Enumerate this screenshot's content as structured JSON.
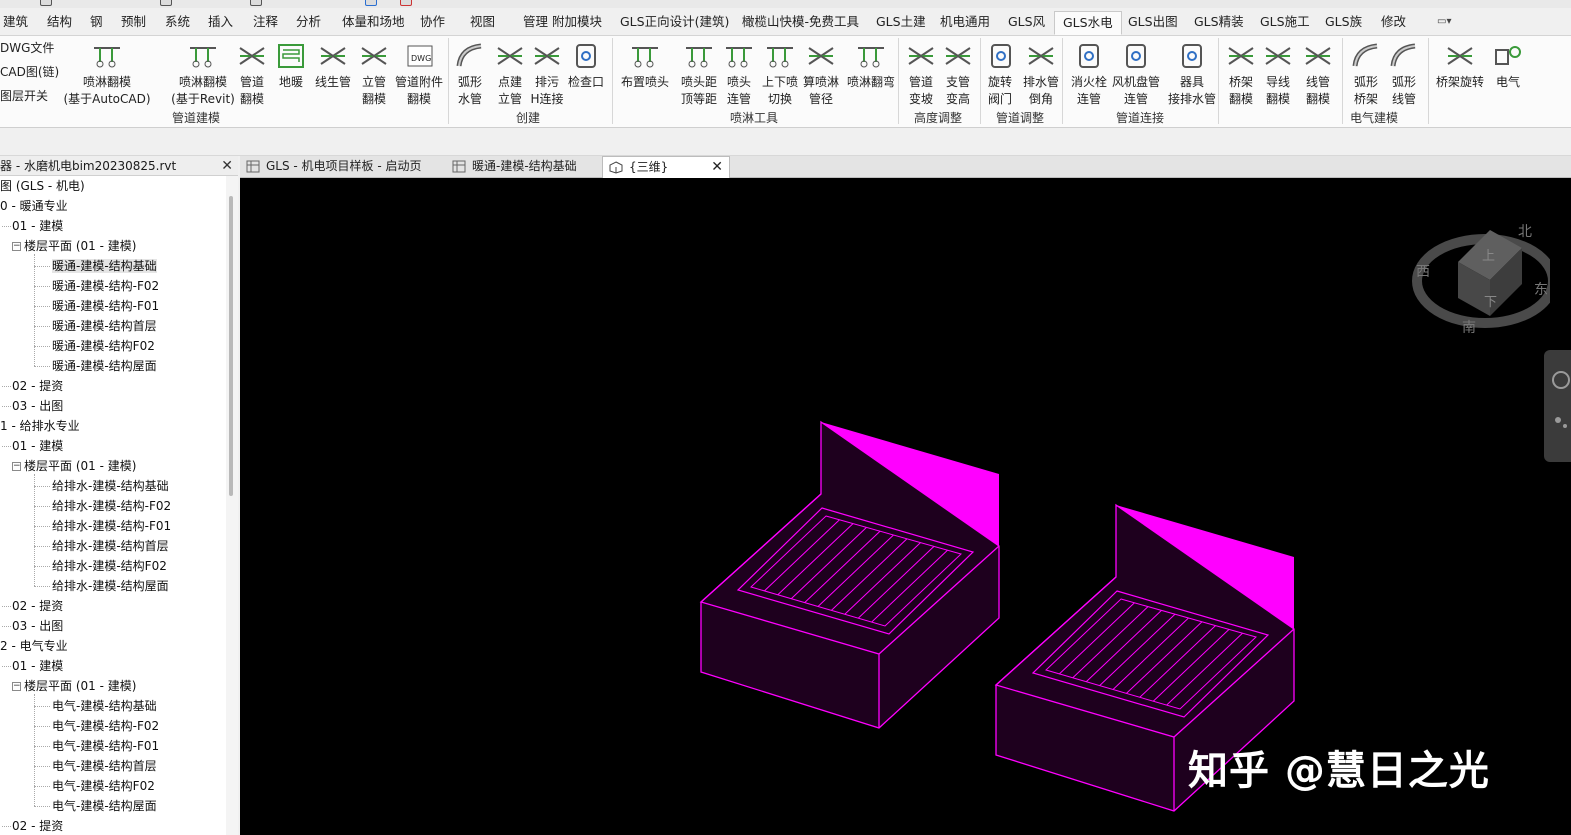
{
  "ribbon_tabs": [
    {
      "label": "建筑",
      "active": false
    },
    {
      "label": "结构",
      "active": false
    },
    {
      "label": "钢",
      "active": false
    },
    {
      "label": "预制",
      "active": false
    },
    {
      "label": "系统",
      "active": false
    },
    {
      "label": "插入",
      "active": false
    },
    {
      "label": "注释",
      "active": false
    },
    {
      "label": "分析",
      "active": false
    },
    {
      "label": "体量和场地",
      "active": false
    },
    {
      "label": "协作",
      "active": false
    },
    {
      "label": "视图",
      "active": false
    },
    {
      "label": "管理",
      "active": false
    },
    {
      "label": "附加模块",
      "active": false
    },
    {
      "label": "GLS正向设计(建筑)",
      "active": false
    },
    {
      "label": "橄榄山快模-免费工具",
      "active": false
    },
    {
      "label": "GLS土建",
      "active": false
    },
    {
      "label": "机电通用",
      "active": false
    },
    {
      "label": "GLS风",
      "active": false
    },
    {
      "label": "GLS水电",
      "active": true
    },
    {
      "label": "GLS出图",
      "active": false
    },
    {
      "label": "GLS精装",
      "active": false
    },
    {
      "label": "GLS施工",
      "active": false
    },
    {
      "label": "GLS族",
      "active": false
    },
    {
      "label": "修改",
      "active": false
    }
  ],
  "ribbon_left_small": [
    "DWG文件",
    "CAD图(链)",
    "图层开关"
  ],
  "ribbon_buttons": [
    {
      "label": "喷淋翻模\n(基于AutoCAD)",
      "icon": "sprinkler-grid-icon"
    },
    {
      "label": "喷淋翻模\n(基于Revit)",
      "icon": "sprinkler-dwg-icon"
    },
    {
      "label": "管道\n翻模",
      "icon": "pipe-layers-icon"
    },
    {
      "label": "地暖",
      "icon": "floor-heating-icon"
    },
    {
      "label": "线生管",
      "icon": "line-to-pipe-icon"
    },
    {
      "label": "立管\n翻模",
      "icon": "riser-icon"
    },
    {
      "label": "管道附件\n翻模",
      "icon": "pipe-accessory-dwg-icon"
    },
    {
      "label": "弧形\n水管",
      "icon": "arc-pipe-icon"
    },
    {
      "label": "点建\n立管",
      "icon": "point-riser-icon"
    },
    {
      "label": "排污\nH连接",
      "icon": "h-connect-icon"
    },
    {
      "label": "检查口",
      "icon": "inspection-port-icon"
    },
    {
      "label": "布置喷头",
      "icon": "place-sprinkler-icon"
    },
    {
      "label": "喷头距\n顶等距",
      "icon": "sprinkler-spacing-icon"
    },
    {
      "label": "喷头\n连管",
      "icon": "sprinkler-connect-icon"
    },
    {
      "label": "上下喷\n切换",
      "icon": "sprinkler-switch-icon"
    },
    {
      "label": "算喷淋\n管径",
      "icon": "pipe-diameter-icon"
    },
    {
      "label": "喷淋翻弯",
      "icon": "sprinkler-bend-icon"
    },
    {
      "label": "管道\n变坡",
      "icon": "pipe-slope-icon"
    },
    {
      "label": "支管\n变高",
      "icon": "branch-height-icon"
    },
    {
      "label": "旋转\n阀门",
      "icon": "rotate-valve-icon"
    },
    {
      "label": "排水管\n倒角",
      "icon": "drain-chamfer-icon"
    },
    {
      "label": "消火栓\n连管",
      "icon": "hydrant-icon"
    },
    {
      "label": "风机盘管\n连管",
      "icon": "fan-coil-icon"
    },
    {
      "label": "器具\n接排水管",
      "icon": "fixture-drain-icon"
    },
    {
      "label": "桥架\n翻模",
      "icon": "tray-model-icon"
    },
    {
      "label": "导线\n翻模",
      "icon": "wire-model-icon"
    },
    {
      "label": "线管\n翻模",
      "icon": "conduit-model-icon"
    },
    {
      "label": "弧形\n桥架",
      "icon": "arc-tray-icon"
    },
    {
      "label": "弧形\n线管",
      "icon": "arc-conduit-icon"
    },
    {
      "label": "桥架旋转",
      "icon": "tray-rotate-icon"
    },
    {
      "label": "电气",
      "icon": "electrical-icon"
    }
  ],
  "ribbon_panels": [
    "管道建模",
    "创建",
    "喷淋工具",
    "高度调整",
    "管道调整",
    "管道连接",
    "电气建模"
  ],
  "browser": {
    "title": "器 - 水磨机电bim20230825.rvt",
    "close": "✕"
  },
  "tree": [
    {
      "label": "图 (GLS - 机电)",
      "level": 0,
      "toggle": "",
      "selected": false
    },
    {
      "label": "0 - 暖通专业",
      "level": 0,
      "toggle": "",
      "selected": false
    },
    {
      "label": "01 - 建模",
      "level": 1,
      "toggle": "",
      "selected": false
    },
    {
      "label": "楼层平面 (01 - 建模)",
      "level": 2,
      "toggle": "−",
      "selected": false
    },
    {
      "label": "暖通-建模-结构基础",
      "level": 3,
      "toggle": "",
      "selected": true
    },
    {
      "label": "暖通-建模-结构-F02",
      "level": 3,
      "toggle": "",
      "selected": false
    },
    {
      "label": "暖通-建模-结构-F01",
      "level": 3,
      "toggle": "",
      "selected": false
    },
    {
      "label": "暖通-建模-结构首层",
      "level": 3,
      "toggle": "",
      "selected": false
    },
    {
      "label": "暖通-建模-结构F02",
      "level": 3,
      "toggle": "",
      "selected": false
    },
    {
      "label": "暖通-建模-结构屋面",
      "level": 3,
      "toggle": "",
      "selected": false
    },
    {
      "label": "02 - 提资",
      "level": 1,
      "toggle": "",
      "selected": false
    },
    {
      "label": "03 - 出图",
      "level": 1,
      "toggle": "",
      "selected": false
    },
    {
      "label": "1 - 给排水专业",
      "level": 0,
      "toggle": "",
      "selected": false
    },
    {
      "label": "01 - 建模",
      "level": 1,
      "toggle": "",
      "selected": false
    },
    {
      "label": "楼层平面 (01 - 建模)",
      "level": 2,
      "toggle": "−",
      "selected": false
    },
    {
      "label": "给排水-建模-结构基础",
      "level": 3,
      "toggle": "",
      "selected": false
    },
    {
      "label": "给排水-建模-结构-F02",
      "level": 3,
      "toggle": "",
      "selected": false
    },
    {
      "label": "给排水-建模-结构-F01",
      "level": 3,
      "toggle": "",
      "selected": false
    },
    {
      "label": "给排水-建模-结构首层",
      "level": 3,
      "toggle": "",
      "selected": false
    },
    {
      "label": "给排水-建模-结构F02",
      "level": 3,
      "toggle": "",
      "selected": false
    },
    {
      "label": "给排水-建模-结构屋面",
      "level": 3,
      "toggle": "",
      "selected": false
    },
    {
      "label": "02 - 提资",
      "level": 1,
      "toggle": "",
      "selected": false
    },
    {
      "label": "03 - 出图",
      "level": 1,
      "toggle": "",
      "selected": false
    },
    {
      "label": "2 - 电气专业",
      "level": 0,
      "toggle": "",
      "selected": false
    },
    {
      "label": "01 - 建模",
      "level": 1,
      "toggle": "",
      "selected": false
    },
    {
      "label": "楼层平面 (01 - 建模)",
      "level": 2,
      "toggle": "−",
      "selected": false
    },
    {
      "label": "电气-建模-结构基础",
      "level": 3,
      "toggle": "",
      "selected": false
    },
    {
      "label": "电气-建模-结构-F02",
      "level": 3,
      "toggle": "",
      "selected": false
    },
    {
      "label": "电气-建模-结构-F01",
      "level": 3,
      "toggle": "",
      "selected": false
    },
    {
      "label": "电气-建模-结构首层",
      "level": 3,
      "toggle": "",
      "selected": false
    },
    {
      "label": "电气-建模-结构F02",
      "level": 3,
      "toggle": "",
      "selected": false
    },
    {
      "label": "电气-建模-结构屋面",
      "level": 3,
      "toggle": "",
      "selected": false
    },
    {
      "label": "02 - 提资",
      "level": 1,
      "toggle": "",
      "selected": false
    }
  ],
  "view_tabs": [
    {
      "label": "GLS - 机电项目样板 - 启动页",
      "icon": "grid-view-icon",
      "active": false
    },
    {
      "label": "暖通-建模-结构基础",
      "icon": "floor-plan-icon",
      "active": false
    },
    {
      "label": "{三维}",
      "icon": "3d-view-icon",
      "active": true,
      "close": "✕"
    }
  ],
  "viewcube": {
    "face_labels": [
      "北",
      "东",
      "南",
      "西",
      "上",
      "下"
    ]
  },
  "colors": {
    "model_edges": "#ff00ff",
    "model_face": "#ff00ff",
    "canvas": "#000000"
  },
  "watermark": "知乎 @慧日之光"
}
